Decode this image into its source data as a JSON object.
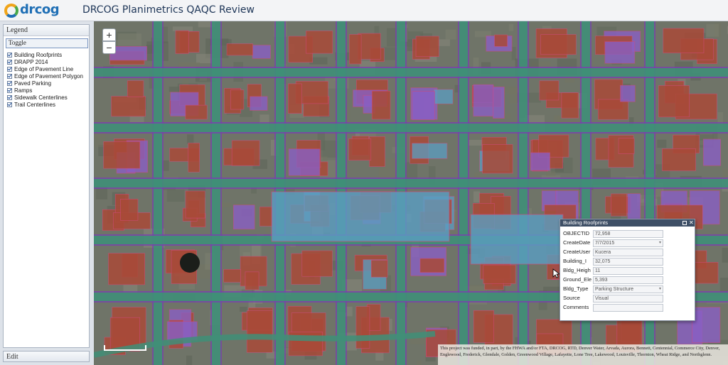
{
  "header": {
    "logo_text": "drcog",
    "title": "DRCOG Planimetrics QAQC Review"
  },
  "sidebar": {
    "legend_title": "Legend",
    "toggle_label": "Toggle",
    "layers": [
      {
        "label": "Building Roofprints",
        "checked": true
      },
      {
        "label": "DRAPP 2014",
        "checked": true
      },
      {
        "label": "Edge of Pavement Line",
        "checked": true
      },
      {
        "label": "Edge of Pavement Polygon",
        "checked": true
      },
      {
        "label": "Paved Parking",
        "checked": true
      },
      {
        "label": "Ramps",
        "checked": true
      },
      {
        "label": "Sidewalk Centerlines",
        "checked": true
      },
      {
        "label": "Trail Centerlines",
        "checked": true
      }
    ],
    "edit_title": "Edit"
  },
  "map": {
    "zoom_in_label": "+",
    "zoom_out_label": "−",
    "attribution": "This project was funded, in part, by the FHWA and/or FTA, DRCOG, RTD, Denver Water, Arvada, Aurora, Bennett, Centennial, Commerce City, Denver, Englewood, Frederick, Glendale, Golden, Greenwood Village, Lafayette, Lone Tree, Lakewood, Louisville, Thornton, Wheat Ridge, and Northglenn.",
    "colors": {
      "parking": "#a94a38",
      "pavement": "#3f8f78",
      "roofprint_purple": "#8a5fc4",
      "roofprint_blue": "#5b9ec2",
      "sidewalk": "#7a3fb0",
      "ground": "#6f7468"
    }
  },
  "popup": {
    "title": "Building Roofprints",
    "maximize_icon": "maximize-icon",
    "close_label": "✕",
    "fields": [
      {
        "label": "OBJECTID",
        "value": "72,958",
        "dropdown": false
      },
      {
        "label": "CreateDate",
        "value": "7/7/2015",
        "dropdown": true
      },
      {
        "label": "CreateUser",
        "value": "Kucera",
        "dropdown": false
      },
      {
        "label": "Building_I",
        "value": "32,075",
        "dropdown": false
      },
      {
        "label": "Bldg_Heigh",
        "value": "11",
        "dropdown": false
      },
      {
        "label": "Ground_Ele",
        "value": "5,393",
        "dropdown": false
      },
      {
        "label": "Bldg_Type",
        "value": "Parking Structure",
        "dropdown": true
      },
      {
        "label": "Source",
        "value": "Visual",
        "dropdown": false
      },
      {
        "label": "Comments",
        "value": "",
        "dropdown": false
      }
    ]
  }
}
